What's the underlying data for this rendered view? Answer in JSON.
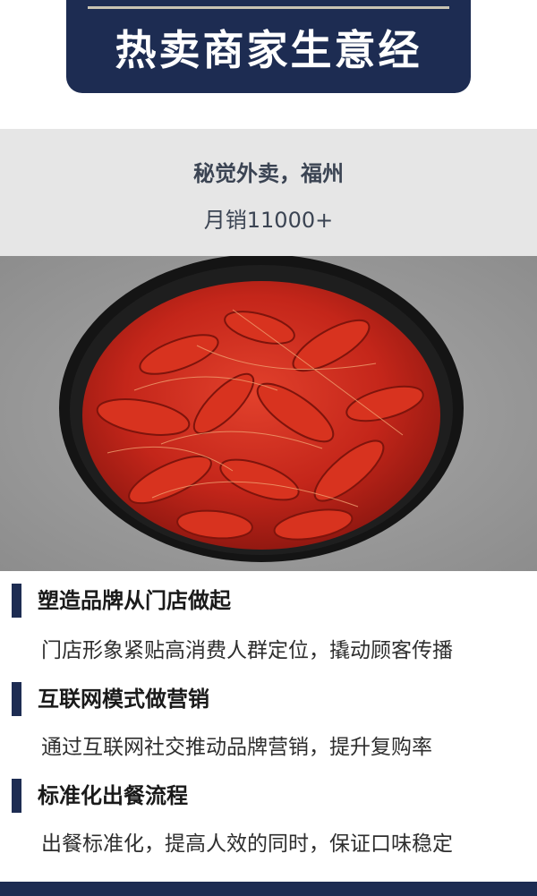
{
  "banner": {
    "title": "热卖商家生意经"
  },
  "merchant": {
    "name": "秘觉外卖，福州",
    "monthly_sales": "月销11000+"
  },
  "photo": {
    "subject": "crayfish-bowl-image"
  },
  "features": [
    {
      "title": "塑造品牌从门店做起",
      "description": "门店形象紧贴高消费人群定位，撬动顾客传播"
    },
    {
      "title": "互联网模式做营销",
      "description": "通过互联网社交推动品牌营销，提升复购率"
    },
    {
      "title": "标准化出餐流程",
      "description": "出餐标准化，提高人效的同时，保证口味稳定"
    }
  ],
  "colors": {
    "navy": "#1d2c52",
    "band_gray": "#e6e6e6",
    "crayfish_red": "#c8281c"
  }
}
